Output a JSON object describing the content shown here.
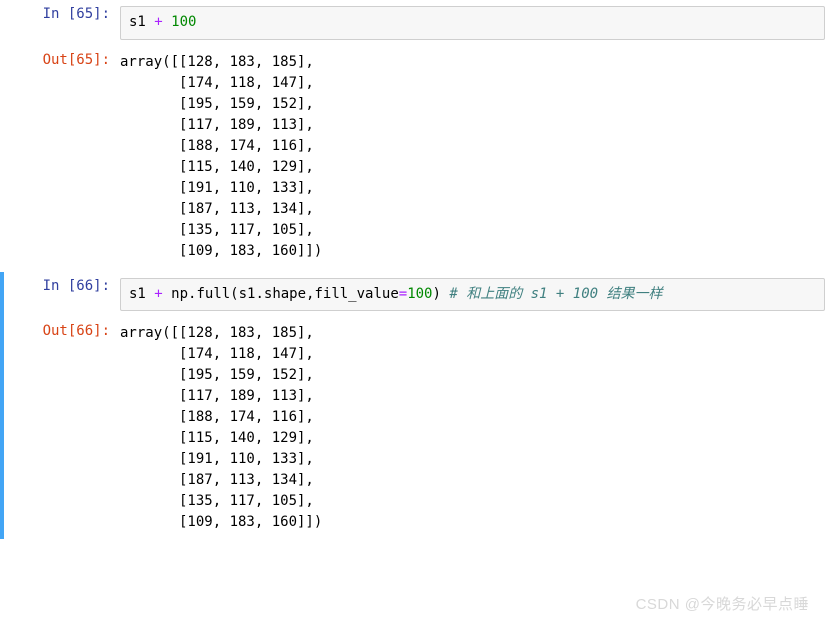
{
  "cells": [
    {
      "prompt_in": "In  [65]:",
      "prompt_out": "Out[65]:",
      "code": {
        "var1": "s1",
        "op": "+",
        "num": "100"
      },
      "output": "array([[128, 183, 185],\n       [174, 118, 147],\n       [195, 159, 152],\n       [117, 189, 113],\n       [188, 174, 116],\n       [115, 140, 129],\n       [191, 110, 133],\n       [187, 113, 134],\n       [135, 117, 105],\n       [109, 183, 160]])"
    },
    {
      "prompt_in": "In  [66]:",
      "prompt_out": "Out[66]:",
      "code": {
        "var1": "s1",
        "op": "+",
        "text1": "np.full(s1.shape,fill_value",
        "eq": "=",
        "num": "100",
        "text2": ")  ",
        "comment": "# 和上面的 s1 + 100 结果一样"
      },
      "output": "array([[128, 183, 185],\n       [174, 118, 147],\n       [195, 159, 152],\n       [117, 189, 113],\n       [188, 174, 116],\n       [115, 140, 129],\n       [191, 110, 133],\n       [187, 113, 134],\n       [135, 117, 105],\n       [109, 183, 160]])"
    }
  ],
  "watermark": "CSDN @今晚务必早点睡"
}
